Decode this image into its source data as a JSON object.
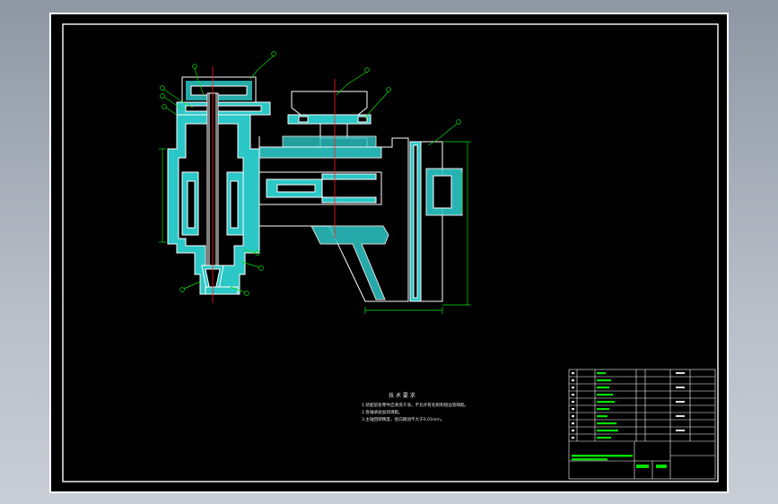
{
  "drawing": {
    "colors": {
      "background": "#000000",
      "outline": "#ffffff",
      "section_fill": "#2cc7c7",
      "dimension": "#00e000",
      "centerline": "#ff2020",
      "viewport": "#b9c0ca"
    },
    "part_labels": [
      "1",
      "2",
      "3",
      "4",
      "5",
      "6",
      "7",
      "8",
      "9",
      "10",
      "11",
      "12"
    ],
    "technical_notes": {
      "title": "技 术 要 求",
      "lines": [
        "1.装配前各零件应清洗干净，不允许有毛刺和锐边等缺陷。",
        "2.各轴承处加润滑脂。",
        "3.主轴回转精度，径向跳动不大于0.01mm。"
      ]
    }
  }
}
